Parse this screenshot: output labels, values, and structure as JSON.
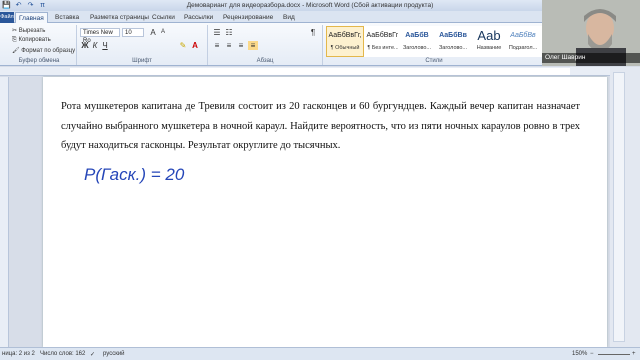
{
  "window": {
    "title": "Демовариант для видеоразбора.docx - Microsoft Word (Сбой активации продукта)"
  },
  "qat": {
    "save": "💾",
    "undo": "↶",
    "redo": "↷",
    "pi": "π"
  },
  "tabs": [
    {
      "label": "Файл"
    },
    {
      "label": "Главная"
    },
    {
      "label": "Вставка"
    },
    {
      "label": "Разметка страницы"
    },
    {
      "label": "Ссылки"
    },
    {
      "label": "Рассылки"
    },
    {
      "label": "Рецензирование"
    },
    {
      "label": "Вид"
    }
  ],
  "clipboard": {
    "cut": "Вырезать",
    "copy": "Копировать",
    "format": "Формат по образцу",
    "group": "Буфер обмена"
  },
  "font": {
    "name": "Times New Ro",
    "size": "10",
    "group": "Шрифт",
    "bold": "Ж",
    "italic": "К",
    "underline": "Ч"
  },
  "paragraph": {
    "group": "Абзац"
  },
  "styles": {
    "group": "Стили",
    "items": [
      {
        "sample": "АаБбВвГг,",
        "name": "¶ Обычный"
      },
      {
        "sample": "АаБбВвГг,",
        "name": "¶ Без инте..."
      },
      {
        "sample": "АаБбВ",
        "name": "Заголово..."
      },
      {
        "sample": "АаБбВв",
        "name": "Заголово..."
      },
      {
        "sample": "Аа​b",
        "name": "Название"
      },
      {
        "sample": "АаБбВв",
        "name": "Подзагол..."
      }
    ]
  },
  "video": {
    "name": "Олег Шаврин"
  },
  "document": {
    "paragraph": "Рота мушкетеров капитана де Тревиля состоит из 20 гасконцев и 60 бургундцев. Каждый вечер капитан назначает случайно выбранного мушкетера в ночной караул. Найдите вероятность, что из пяти ночных караулов ровно в трех будут находиться гасконцы. Результат округлите до тысячных.",
    "handwriting": "P(Гаск.) = 20"
  },
  "status": {
    "page": "ница: 2 из 2",
    "words": "Число слов: 162",
    "lang": "русский",
    "zoom": "150%"
  },
  "colors": {
    "accent": "#2b579a",
    "ink": "#2546b8",
    "selected_style": "#fdf1cf"
  }
}
